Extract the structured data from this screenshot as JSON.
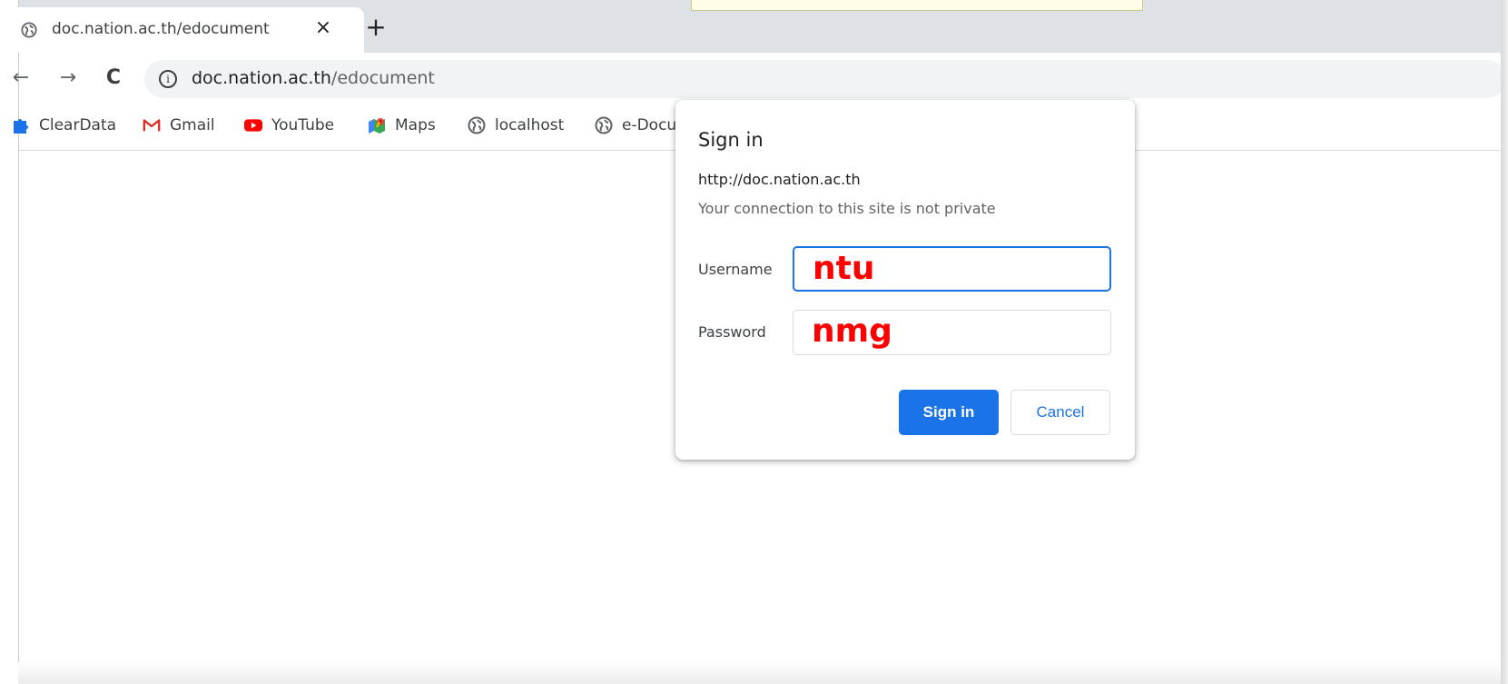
{
  "tab": {
    "title": "doc.nation.ac.th/edocument",
    "close_glyph": "×",
    "new_tab_glyph": "+"
  },
  "toolbar": {
    "back_glyph": "←",
    "forward_glyph": "→",
    "reload_glyph": "C",
    "info_glyph": "i",
    "url_host": "doc.nation.ac.th",
    "url_path": "/edocument"
  },
  "bookmarks": [
    {
      "label": "ClearData",
      "icon": "puzzle-icon"
    },
    {
      "label": "Gmail",
      "icon": "gmail-icon"
    },
    {
      "label": "YouTube",
      "icon": "youtube-icon"
    },
    {
      "label": "Maps",
      "icon": "maps-icon"
    },
    {
      "label": "localhost",
      "icon": "globe-icon"
    },
    {
      "label": "e-Docu",
      "icon": "globe-icon"
    }
  ],
  "dialog": {
    "title": "Sign in",
    "origin": "http://doc.nation.ac.th",
    "warning": "Your connection to this site is not private",
    "username_label": "Username",
    "username_value": "ntu",
    "password_label": "Password",
    "password_value": "nmg",
    "sign_in_label": "Sign in",
    "cancel_label": "Cancel"
  },
  "colors": {
    "accent": "#1a73e8",
    "annotation_red": "#ff0000",
    "tabstrip": "#dee1e6"
  }
}
